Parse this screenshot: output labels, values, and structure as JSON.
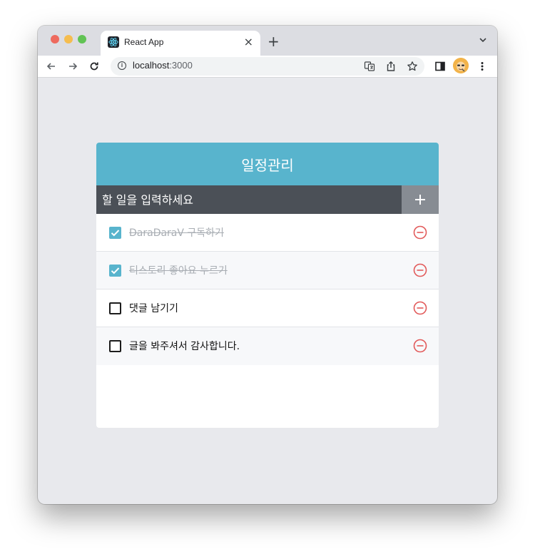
{
  "browser": {
    "tab_title": "React App",
    "url_host": "localhost",
    "url_port": ":3000",
    "new_tab_label": "+",
    "tab_close_label": "×"
  },
  "app": {
    "title": "일정관리",
    "input_placeholder": "할 일을 입력하세요",
    "todos": [
      {
        "text": "DaraDaraV 구독하기",
        "checked": true
      },
      {
        "text": "티스토리 좋아요 누르기",
        "checked": true
      },
      {
        "text": "댓글 남기기",
        "checked": false
      },
      {
        "text": "글을 봐주셔서 감사합니다.",
        "checked": false
      }
    ]
  },
  "colors": {
    "header": "#58b4cd",
    "insert_bar": "#4b5057",
    "insert_button": "#878c93",
    "remove_icon": "#e25a5a",
    "checked": "#58b4cd"
  }
}
